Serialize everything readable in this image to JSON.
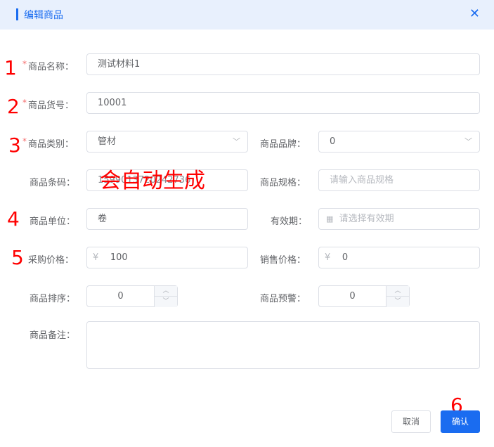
{
  "dialog": {
    "title": "编辑商品",
    "close_icon": "close-icon"
  },
  "fields": {
    "name": {
      "label": "商品名称：",
      "value": "测试材料1",
      "required": true
    },
    "code": {
      "label": "商品货号：",
      "value": "10001",
      "required": true
    },
    "category": {
      "label": "商品类别：",
      "value": "管材",
      "required": true
    },
    "brand": {
      "label": "商品品牌：",
      "value": "0"
    },
    "barcode": {
      "label": "商品条码：",
      "value": "1599013720242736"
    },
    "spec": {
      "label": "商品规格：",
      "placeholder": "请输入商品规格"
    },
    "unit": {
      "label": "商品单位：",
      "value": "卷"
    },
    "expiry": {
      "label": "有效期：",
      "placeholder": "请选择有效期"
    },
    "purchase_price": {
      "label": "采购价格：",
      "prefix": "¥",
      "value": "100"
    },
    "sale_price": {
      "label": "销售价格：",
      "prefix": "¥",
      "value": "0"
    },
    "sort": {
      "label": "商品排序：",
      "value": "0"
    },
    "warning": {
      "label": "商品预警：",
      "value": "0"
    },
    "remark": {
      "label": "商品备注：",
      "value": ""
    }
  },
  "annotations": {
    "n1": "1",
    "n2": "2",
    "n3": "3",
    "n4": "4",
    "n5": "5",
    "n6": "6",
    "auto": "会自动生成"
  },
  "buttons": {
    "cancel": "取消",
    "confirm": "确认"
  },
  "required_mark": "*",
  "colors": {
    "primary": "#1a6cf0",
    "annotation": "#ff0000"
  }
}
